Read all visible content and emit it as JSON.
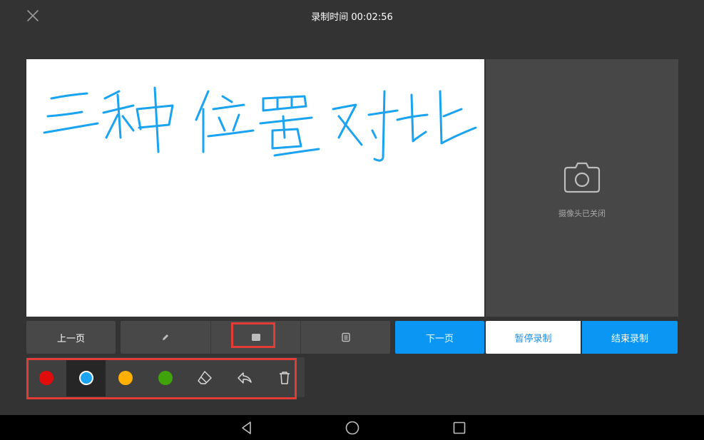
{
  "header": {
    "close_icon": "close-icon",
    "title": "录制时间 00:02:56"
  },
  "whiteboard": {
    "background": "#ffffff",
    "ink_color": "#1aa3f0",
    "handwriting_text": "三种位置对比"
  },
  "camera": {
    "icon": "camera-icon",
    "status_text": "摄像头已关闭"
  },
  "toolbar": {
    "prev_label": "上一页",
    "modes": [
      {
        "icon": "pen-icon"
      },
      {
        "icon": "square-icon",
        "highlighted": true
      },
      {
        "icon": "list-icon"
      }
    ],
    "next_label": "下一页",
    "pause_label": "暂停录制",
    "end_label": "结束录制"
  },
  "palette": {
    "colors": [
      "#e00b0b",
      "#1aa3f0",
      "#ffb000",
      "#41a30c"
    ],
    "selected": "#1aa3f0",
    "tools": [
      "eraser-icon",
      "undo-icon",
      "trash-icon"
    ]
  },
  "colors": {
    "accent": "#0a96f2",
    "highlight_box": "#e33b35"
  },
  "navbar": {
    "buttons": [
      "back-icon",
      "home-icon",
      "recents-icon"
    ]
  }
}
